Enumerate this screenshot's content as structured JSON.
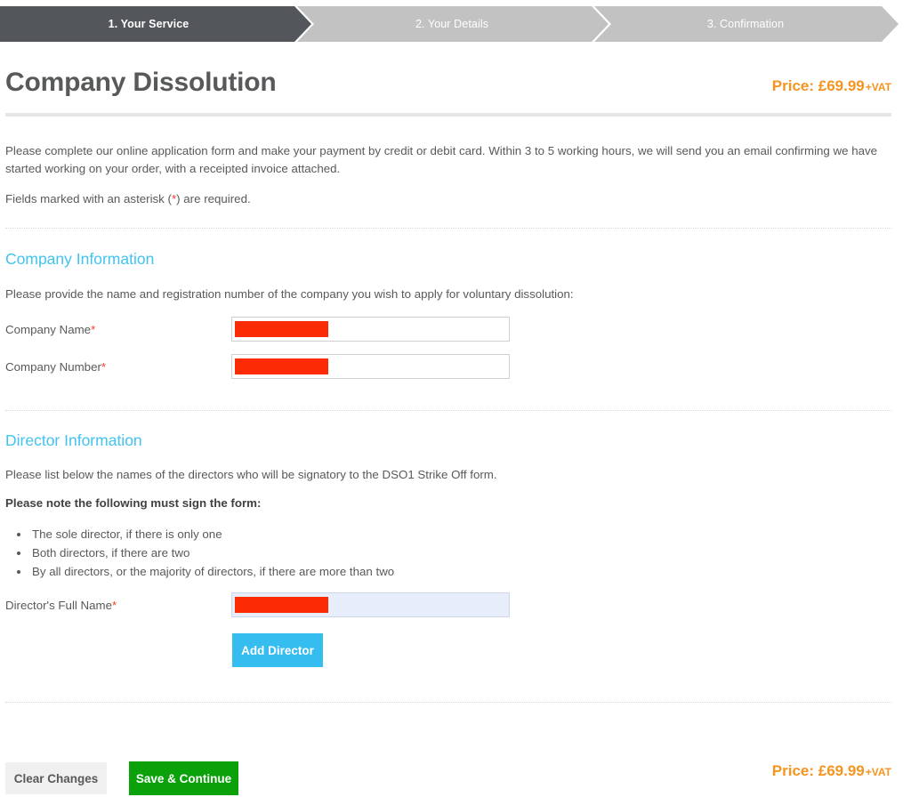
{
  "steps": [
    {
      "label": "1. Your Service",
      "state": "active"
    },
    {
      "label": "2. Your Details",
      "state": "inactive"
    },
    {
      "label": "3. Confirmation",
      "state": "inactive"
    }
  ],
  "header": {
    "title": "Company Dissolution",
    "price_amount": "Price: £69.99",
    "price_vat": "+VAT"
  },
  "intro": {
    "paragraph": "Please complete our online application form and make your payment by credit or debit card. Within 3 to 5 working hours, we will send you an email confirming we have started working on your order, with a receipted invoice attached.",
    "required_prefix": "Fields marked with an asterisk (",
    "required_star": "*",
    "required_suffix": ") are required."
  },
  "company_section": {
    "heading": "Company Information",
    "description": "Please provide the name and registration number of the company you wish to apply for voluntary dissolution:",
    "fields": [
      {
        "label": "Company Name",
        "required_mark": "*",
        "value": "",
        "redacted": true,
        "focused": false
      },
      {
        "label": "Company Number",
        "required_mark": "*",
        "value": "",
        "redacted": true,
        "focused": false
      }
    ]
  },
  "director_section": {
    "heading": "Director Information",
    "description": "Please list below the names of the directors who will be signatory to the DSO1 Strike Off form.",
    "note": "Please note the following must sign the form:",
    "rules": [
      "The sole director, if there is only one",
      "Both directors, if there are two",
      "By all directors, or the majority of directors, if there are more than two"
    ],
    "field": {
      "label": "Director's Full Name",
      "required_mark": "*",
      "value": "",
      "redacted": true,
      "focused": true
    },
    "add_button": "Add Director"
  },
  "footer": {
    "clear_button": "Clear Changes",
    "save_button": "Save & Continue",
    "price_amount": "Price: £69.99",
    "price_vat": "+VAT"
  },
  "colors": {
    "accent_blue": "#41c3f0",
    "price_orange": "#f7941e",
    "active_step": "#53565a",
    "inactive_step": "#c2c2c2",
    "save_green": "#0ba10b",
    "add_blue": "#36bdef",
    "required_red": "#ff3b22",
    "redaction_red": "#fb2b06"
  }
}
